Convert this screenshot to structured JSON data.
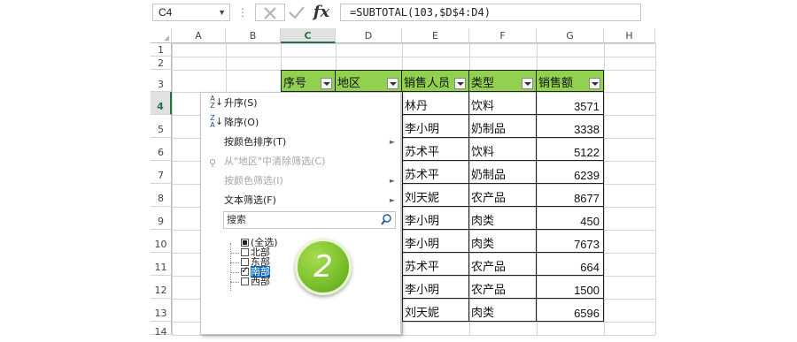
{
  "formula_bar": {
    "name_box": "C4",
    "formula": "=SUBTOTAL(103,$D$4:D4)",
    "cancel_icon": "close-icon",
    "enter_icon": "check-icon",
    "fx_label": "fx"
  },
  "columns": [
    "A",
    "B",
    "C",
    "D",
    "E",
    "F",
    "G",
    "H"
  ],
  "rows": [
    "1",
    "2",
    "3",
    "4",
    "5",
    "6",
    "7",
    "8",
    "9",
    "10",
    "11",
    "12",
    "13",
    "14"
  ],
  "table": {
    "headers": [
      "序号",
      "地区",
      "销售人员",
      "类型",
      "销售额"
    ],
    "data": [
      {
        "person": "林丹",
        "type": "饮料",
        "amount": "3571"
      },
      {
        "person": "李小明",
        "type": "奶制品",
        "amount": "3338"
      },
      {
        "person": "苏术平",
        "type": "饮料",
        "amount": "5122"
      },
      {
        "person": "苏术平",
        "type": "奶制品",
        "amount": "6239"
      },
      {
        "person": "刘天妮",
        "type": "农产品",
        "amount": "8677"
      },
      {
        "person": "李小明",
        "type": "肉类",
        "amount": "450"
      },
      {
        "person": "李小明",
        "type": "肉类",
        "amount": "7673"
      },
      {
        "person": "苏术平",
        "type": "农产品",
        "amount": "664"
      },
      {
        "person": "李小明",
        "type": "农产品",
        "amount": "1500"
      },
      {
        "person": "刘天妮",
        "type": "肉类",
        "amount": "6596"
      }
    ]
  },
  "filter_menu": {
    "items": [
      {
        "label": "升序(S)",
        "icon": "sort-ascending-icon",
        "disabled": false,
        "submenu": false
      },
      {
        "label": "降序(O)",
        "icon": "sort-descending-icon",
        "disabled": false,
        "submenu": false
      },
      {
        "label": "按颜色排序(T)",
        "icon": "",
        "disabled": false,
        "submenu": true
      },
      {
        "label": "从\"地区\"中清除筛选(C)",
        "icon": "clear-filter-icon",
        "disabled": true,
        "submenu": false
      },
      {
        "label": "按颜色筛选(I)",
        "icon": "",
        "disabled": true,
        "submenu": true
      },
      {
        "label": "文本筛选(F)",
        "icon": "",
        "disabled": false,
        "submenu": true
      }
    ],
    "search_placeholder": "搜索",
    "checklist": [
      {
        "label": "(全选)",
        "state": "partial"
      },
      {
        "label": "北部",
        "state": "unchecked"
      },
      {
        "label": "东部",
        "state": "unchecked"
      },
      {
        "label": "南部",
        "state": "checked",
        "highlighted": true
      },
      {
        "label": "西部",
        "state": "unchecked"
      }
    ]
  },
  "callout": {
    "label": "2",
    "color": "#7cc22e"
  },
  "colors": {
    "header_fill": "#92d050",
    "excel_green": "#217346",
    "selection_blue": "#0b6cc7"
  }
}
